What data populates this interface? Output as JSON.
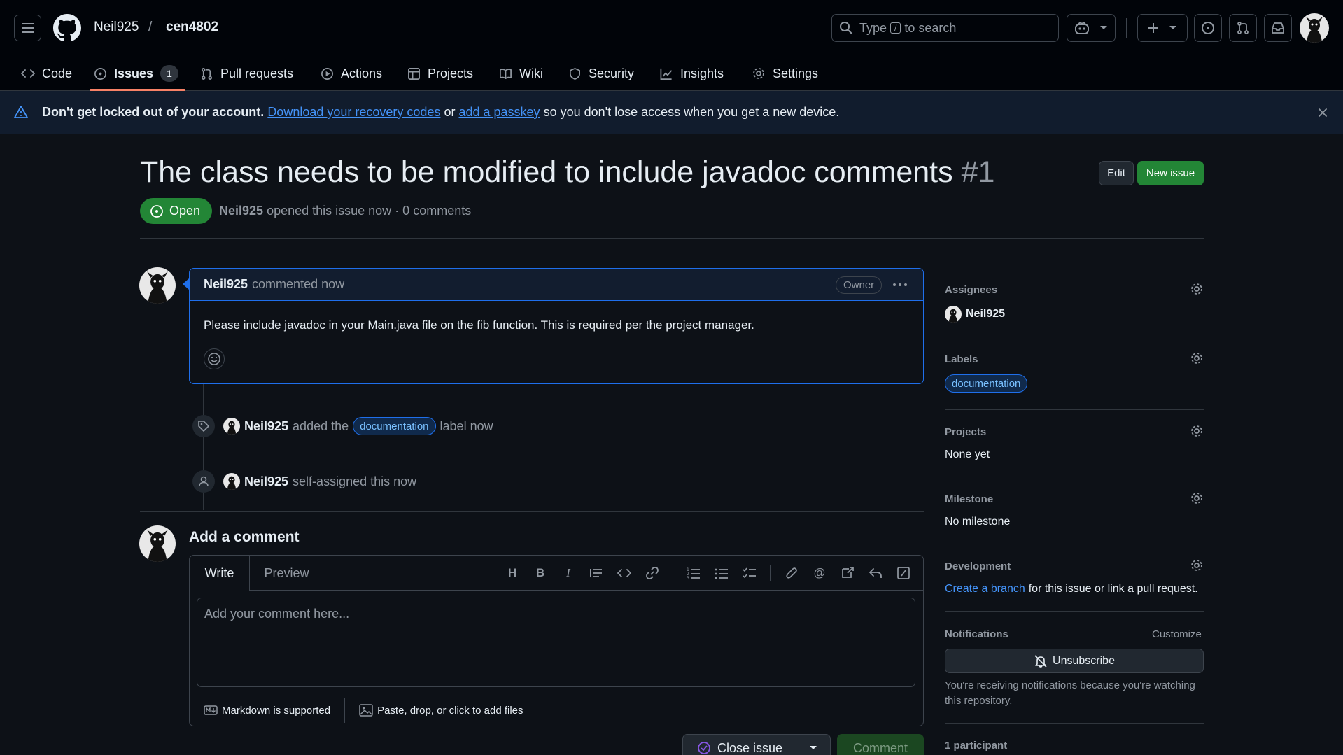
{
  "repo": {
    "owner": "Neil925",
    "separator": "/",
    "name": "cen4802"
  },
  "search": {
    "prefix": "Type",
    "key": "/",
    "suffix": "to search"
  },
  "tabs": [
    {
      "label": "Code",
      "icon": "code-icon"
    },
    {
      "label": "Issues",
      "icon": "issue-opened-icon",
      "count": "1",
      "active": true
    },
    {
      "label": "Pull requests",
      "icon": "git-pull-request-icon"
    },
    {
      "label": "Actions",
      "icon": "play-icon"
    },
    {
      "label": "Projects",
      "icon": "table-icon"
    },
    {
      "label": "Wiki",
      "icon": "book-icon"
    },
    {
      "label": "Security",
      "icon": "shield-icon"
    },
    {
      "label": "Insights",
      "icon": "graph-icon"
    },
    {
      "label": "Settings",
      "icon": "gear-icon"
    }
  ],
  "banner": {
    "bold": "Don't get locked out of your account.",
    "link1": "Download your recovery codes",
    "or": "or",
    "link2": "add a passkey",
    "rest": "so you don't lose access when you get a new device."
  },
  "issue": {
    "title": "The class needs to be modified to include javadoc comments",
    "number": "#1",
    "edit_label": "Edit",
    "new_label": "New issue",
    "state": "Open",
    "author": "Neil925",
    "meta": "opened this issue now · 0 comments"
  },
  "comment": {
    "author": "Neil925",
    "when": "commented now",
    "role": "Owner",
    "body": "Please include javadoc in your Main.java file on the fib function. This is required per the project manager."
  },
  "events": [
    {
      "user": "Neil925",
      "pre": "added the",
      "label": "documentation",
      "post": "label now"
    },
    {
      "user": "Neil925",
      "text": "self-assigned this now"
    }
  ],
  "composer": {
    "title": "Add a comment",
    "tab_write": "Write",
    "tab_preview": "Preview",
    "placeholder": "Add your comment here...",
    "markdown": "Markdown is supported",
    "attach": "Paste, drop, or click to add files",
    "close_label": "Close issue",
    "comment_label": "Comment"
  },
  "sidebar": {
    "assignees": {
      "title": "Assignees",
      "value": "Neil925"
    },
    "labels": {
      "title": "Labels",
      "value": "documentation"
    },
    "projects": {
      "title": "Projects",
      "value": "None yet"
    },
    "milestone": {
      "title": "Milestone",
      "value": "No milestone"
    },
    "development": {
      "title": "Development",
      "link": "Create a branch",
      "rest": "for this issue or link a pull request."
    },
    "notifications": {
      "title": "Notifications",
      "customize": "Customize",
      "button": "Unsubscribe",
      "note": "You're receiving notifications because you're watching this repository."
    },
    "participants": "1 participant"
  },
  "colors": {
    "accent": "#1f6feb",
    "open": "#238636",
    "tab_underline": "#f78166",
    "bg": "#0d1117"
  }
}
